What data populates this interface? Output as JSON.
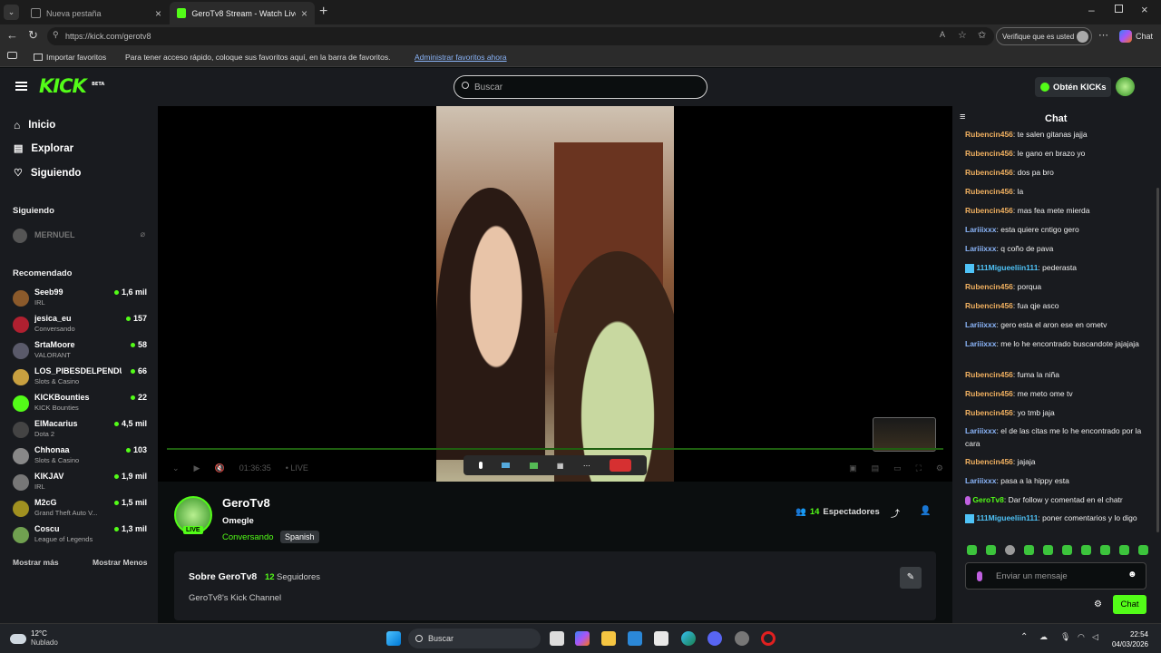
{
  "browser": {
    "tabs": [
      {
        "label": "Nueva pestaña",
        "active": false
      },
      {
        "label": "GeroTv8 Stream - Watch Live on K",
        "active": true
      }
    ],
    "url": "https://kick.com/gerotv8",
    "verify_label": "Verifique que es usted",
    "chat_label": "Chat",
    "favbar": {
      "import_label": "Importar favoritos",
      "hint": "Para tener acceso rápido, coloque sus favoritos aquí, en la barra de favoritos.",
      "manage_link": "Administrar favoritos ahora"
    }
  },
  "header": {
    "logo": "KICK",
    "logo_badge": "BETA",
    "search_placeholder": "Buscar",
    "get_kicks": "Obtén KICKs"
  },
  "sidebar": {
    "nav": [
      {
        "label": "Inicio",
        "icon": "home-icon"
      },
      {
        "label": "Explorar",
        "icon": "explore-icon"
      },
      {
        "label": "Siguiendo",
        "icon": "heart-icon"
      }
    ],
    "following_title": "Siguiendo",
    "following": [
      {
        "name": "MERNUEL"
      }
    ],
    "recommended_title": "Recomendado",
    "recommended": [
      {
        "name": "Seeb99",
        "category": "IRL",
        "viewers": "1,6 mil",
        "color": "#8b5a2b"
      },
      {
        "name": "jesica_eu",
        "category": "Conversando",
        "viewers": "157",
        "color": "#b02030"
      },
      {
        "name": "SrtaMoore",
        "category": "VALORANT",
        "viewers": "58",
        "color": "#5a5a6a"
      },
      {
        "name": "LOS_PIBESDELPENDUL",
        "category": "Slots & Casino",
        "viewers": "66",
        "color": "#c8a040"
      },
      {
        "name": "KICKBounties",
        "category": "KICK Bounties",
        "viewers": "22",
        "color": "#53fc18"
      },
      {
        "name": "ElMacarius",
        "category": "Dota 2",
        "viewers": "4,5 mil",
        "color": "#444444"
      },
      {
        "name": "Chhonaa",
        "category": "Slots & Casino",
        "viewers": "103",
        "color": "#888888"
      },
      {
        "name": "KIKJAV",
        "category": "IRL",
        "viewers": "1,9 mil",
        "color": "#777777"
      },
      {
        "name": "M2cG",
        "category": "Grand Theft Auto V...",
        "viewers": "1,5 mil",
        "color": "#a09020"
      },
      {
        "name": "Coscu",
        "category": "League of Legends",
        "viewers": "1,3 mil",
        "color": "#70a050"
      }
    ],
    "show_more": "Mostrar más",
    "show_less": "Mostrar Menos"
  },
  "player": {
    "time": "01:36:35",
    "live_label": "LIVE"
  },
  "streamer": {
    "name": "GeroTv8",
    "title": "Omegle",
    "category": "Conversando",
    "tag": "Spanish",
    "live_badge": "LIVE",
    "viewers": "14",
    "viewers_label": "Espectadores",
    "about_title": "Sobre GeroTv8",
    "followers": "12",
    "followers_label": "Seguidores",
    "about_text": "GeroTv8's Kick Channel"
  },
  "chat": {
    "title": "Chat",
    "messages": [
      {
        "user": "Rubencin456",
        "text": "te salen gitanas jajja",
        "color": "orange"
      },
      {
        "user": "Rubencin456",
        "text": "le gano en brazo yo",
        "color": "orange"
      },
      {
        "user": "Rubencin456",
        "text": "dos pa bro",
        "color": "orange"
      },
      {
        "user": "Rubencin456",
        "text": "la",
        "color": "orange"
      },
      {
        "user": "Rubencin456",
        "text": "mas fea mete mierda",
        "color": "orange"
      },
      {
        "user": "Lariiixxx",
        "text": "esta quiere cntigo gero",
        "color": "blue"
      },
      {
        "user": "Lariiixxx",
        "text": "q coño de pava",
        "color": "blue"
      },
      {
        "user": "111Migueeliin111",
        "text": "pederasta",
        "color": "cyan"
      },
      {
        "user": "Rubencin456",
        "text": "porqua",
        "color": "orange"
      },
      {
        "user": "Rubencin456",
        "text": "fua qje asco",
        "color": "orange"
      },
      {
        "user": "Lariiixxx",
        "text": "gero esta el aron ese en ometv",
        "color": "blue"
      },
      {
        "user": "Lariiixxx",
        "text": "me lo he encontrado buscandote jajajaja",
        "color": "blue"
      },
      {
        "user": "Rubencin456",
        "text": "fuma la niña",
        "color": "orange"
      },
      {
        "user": "Rubencin456",
        "text": "me meto ome tv",
        "color": "orange"
      },
      {
        "user": "Rubencin456",
        "text": "yo tmb jaja",
        "color": "orange"
      },
      {
        "user": "Lariiixxx",
        "text": "el de las citas me lo he encontrado por la cara",
        "color": "blue"
      },
      {
        "user": "Rubencin456",
        "text": "jajaja",
        "color": "orange"
      },
      {
        "user": "Lariiixxx",
        "text": "pasa a la hippy esta",
        "color": "blue"
      },
      {
        "user": "GeroTv8",
        "text": "Dar follow y comentad en el chatr",
        "color": "green"
      },
      {
        "user": "111Migueeliin111",
        "text": "poner comentarios y lo digo",
        "color": "cyan"
      }
    ],
    "input_placeholder": "Enviar un mensaje",
    "send_label": "Chat"
  },
  "taskbar": {
    "weather_temp": "12°C",
    "weather_desc": "Nublado",
    "search_placeholder": "Buscar",
    "time": "22:54",
    "date": "04/03/2026"
  }
}
